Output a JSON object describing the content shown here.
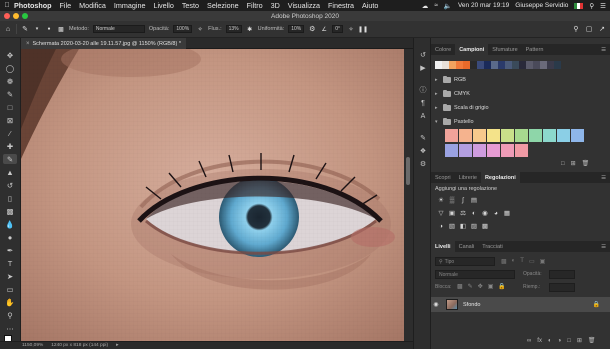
{
  "menubar": {
    "apple_icon": "apple-icon",
    "items": [
      "Photoshop",
      "File",
      "Modifica",
      "Immagine",
      "Livello",
      "Testo",
      "Selezione",
      "Filtro",
      "3D",
      "Visualizza",
      "Finestra",
      "Aiuto"
    ],
    "datetime": "Ven 20 mar  19:19",
    "user": "Giuseppe Servidio"
  },
  "window": {
    "title": "Adobe Photoshop 2020"
  },
  "options": {
    "metodo_label": "Metodo:",
    "metodo_value": "Normale",
    "opacita_label": "Opacità:",
    "opacita_value": "100%",
    "flusso_label": "Flus.:",
    "flusso_value": "13%",
    "uniformita_label": "Uniformità:",
    "uniformita_value": "10%",
    "angle_value": "0°"
  },
  "document": {
    "tab_label": "Schermata 2020-03-20 alle 19.11.57.jpg @ 1150% (RGB/8) *",
    "zoom": "1150,09%",
    "size_info": "1240 px x 818 px (144 ppi)"
  },
  "swatches_panel": {
    "tabs": [
      "Colore",
      "Campioni",
      "Sfumature",
      "Pattern"
    ],
    "active_tab": "Campioni",
    "recent_colors": [
      "#f0f0f0",
      "#e8e0d8",
      "#f2a35f",
      "#f07a3a",
      "#e86a2a",
      "#2a2a2a",
      "#3a4a7a",
      "#1a2a5a",
      "#5a6a8a",
      "#2a3a6a",
      "#4a5a7a",
      "#3a4a5a",
      "#2a2a3a",
      "#5a5a6a",
      "#4a4a5a",
      "#6a6a7a",
      "#3a3a4a",
      "#2a3a4a"
    ],
    "groups": [
      "RGB",
      "CMYK",
      "Scala di grigio",
      "Pastello"
    ],
    "pastel_row1": [
      "#f0a39a",
      "#f5b38e",
      "#f6c98c",
      "#f4e38a",
      "#c9e08a",
      "#a7d98f",
      "#8ed6a9",
      "#8cd8cc",
      "#8bcfe6",
      "#8eb6ea"
    ],
    "pastel_row2": [
      "#9aa2e2",
      "#b39ee0",
      "#cf9cdf",
      "#e69bd2",
      "#ee9bb6",
      "#f09aa4"
    ]
  },
  "adjustments_panel": {
    "tabs": [
      "Scopri",
      "Librerie",
      "Regolazioni"
    ],
    "active_tab": "Regolazioni",
    "add_label": "Aggiungi una regolazione",
    "row1_icons": [
      "brightness-icon",
      "levels-icon",
      "curves-icon",
      "exposure-icon"
    ],
    "row2_icons": [
      "vibrance-icon",
      "hue-saturation-icon",
      "color-balance-icon",
      "black-white-icon",
      "photo-filter-icon",
      "channel-mixer-icon",
      "color-lookup-icon"
    ],
    "row3_icons": [
      "invert-icon",
      "posterize-icon",
      "threshold-icon",
      "gradient-map-icon",
      "selective-color-icon"
    ]
  },
  "layers_panel": {
    "tabs": [
      "Livelli",
      "Canali",
      "Tracciati"
    ],
    "active_tab": "Livelli",
    "filter_placeholder": "Tipo",
    "blend_mode": "Normale",
    "opacity_label": "Opacità:",
    "lock_label": "Blocca:",
    "fill_label": "Riemp.:",
    "layer_name": "Sfondo"
  },
  "colors": {
    "menubar_bg": "#1e1e1e",
    "panel_bg": "#323232",
    "iris": "#5fa9cf"
  }
}
